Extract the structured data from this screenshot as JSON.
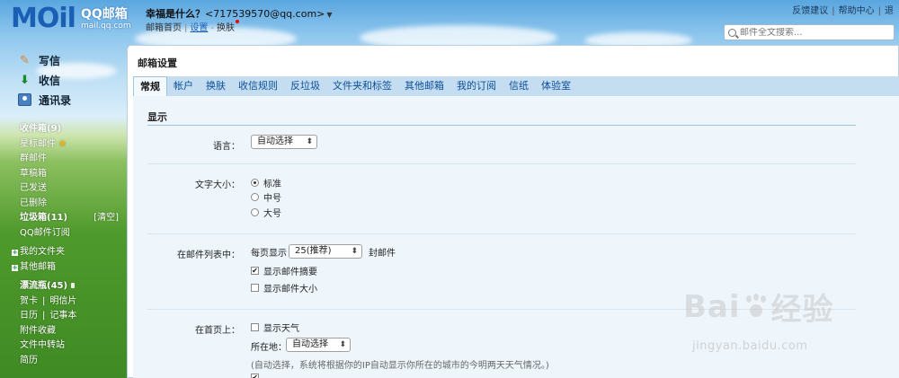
{
  "header": {
    "logo_text": "MOil",
    "logo_brand": "QQ邮箱",
    "logo_domain": "mail.qq.com",
    "nickname": "幸福是什么？",
    "email": "<717539570@qq.com>",
    "links": [
      "邮箱首页",
      "设置",
      "换肤"
    ],
    "toplinks": [
      "反馈建议",
      "帮助中心",
      "退"
    ],
    "search_placeholder": "邮件全文搜索..."
  },
  "sidebar": {
    "top_items": [
      "写信",
      "收信",
      "通讯录"
    ],
    "folders": {
      "inbox": "收件箱(9)",
      "starred": "星标邮件",
      "group": "群邮件",
      "drafts": "草稿箱",
      "sent": "已发送",
      "deleted": "已删除",
      "spam": "垃圾箱(11)",
      "spam_clear": "[清空]",
      "subscriptions": "QQ邮件订阅",
      "my_folders": "我的文件夹",
      "other_mail": "其他邮箱",
      "drift_bottle": "漂流瓶(45)",
      "card": "贺卡",
      "postcard": "明信片",
      "calendar": "日历",
      "notebook": "记事本",
      "attachments": "附件收藏",
      "file_transfer": "文件中转站",
      "resume": "简历"
    }
  },
  "panel": {
    "title": "邮箱设置",
    "tabs": [
      "常规",
      "帐户",
      "换肤",
      "收信规则",
      "反垃圾",
      "文件夹和标签",
      "其他邮箱",
      "我的订阅",
      "信纸",
      "体验室"
    ],
    "active_tab": "常规",
    "section": "显示",
    "language": {
      "label": "语言：",
      "value": "自动选择"
    },
    "font_size": {
      "label": "文字大小：",
      "options": [
        "标准",
        "中号",
        "大号"
      ],
      "selected": "标准"
    },
    "mail_list": {
      "label": "在邮件列表中：",
      "per_page_prefix": "每页显示",
      "per_page_value": "25(推荐)",
      "per_page_suffix": "封邮件",
      "show_summary": "显示邮件摘要",
      "show_summary_checked": true,
      "show_size": "显示邮件大小",
      "show_size_checked": false
    },
    "homepage": {
      "label": "在首页上：",
      "show_weather": "显示天气",
      "show_weather_checked": false,
      "location_label": "所在地：",
      "location_value": "自动选择",
      "hint": "(自动选择，系统将根据你的IP自动显示你所在的城市的今明两天天气情况。)"
    }
  },
  "watermark": {
    "text_left": "Bai",
    "text_right": "经验",
    "url": "jingyan.baidu.com"
  },
  "icons": {
    "write": "pencil-icon",
    "inbox": "inbox-icon",
    "contacts": "contacts-icon",
    "search": "search-icon"
  }
}
